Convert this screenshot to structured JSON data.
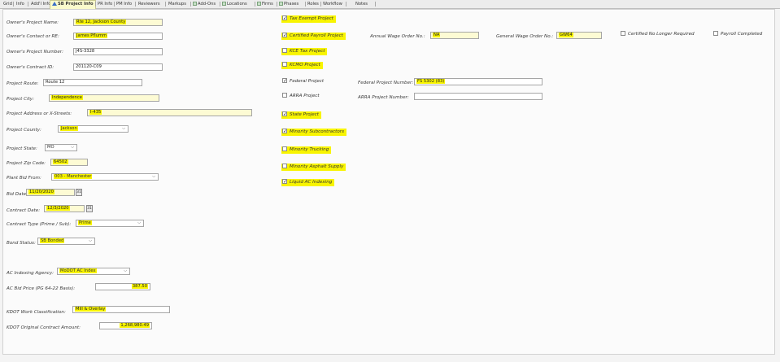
{
  "tabs": [
    {
      "label": "Grid",
      "icon": "none"
    },
    {
      "label": "Info",
      "icon": "none"
    },
    {
      "label": "Add'l Info",
      "icon": "none"
    },
    {
      "label": "SB Project Info",
      "icon": "triangle-icon",
      "active": true
    },
    {
      "label": "PR Info",
      "icon": "none"
    },
    {
      "label": "PM Info",
      "icon": "none"
    },
    {
      "label": "Reviewers",
      "icon": "none"
    },
    {
      "label": "Markups",
      "icon": "none"
    },
    {
      "label": "Add-Ons",
      "icon": "grid-icon"
    },
    {
      "label": "Locations",
      "icon": "grid-icon"
    },
    {
      "label": "Firms",
      "icon": "grid-icon"
    },
    {
      "label": "Phases",
      "icon": "grid-icon"
    },
    {
      "label": "Roles",
      "icon": "none"
    },
    {
      "label": "Workflow",
      "icon": "none"
    },
    {
      "label": "Notes",
      "icon": "none"
    }
  ],
  "form": {
    "project_name": {
      "label": "Owner's Project Name:",
      "value": "Rte 12, Jackson County"
    },
    "contact": {
      "label": "Owner's Contact or RE:",
      "value": "James Pflumm"
    },
    "project_number": {
      "label": "Owner's Project Number:",
      "value": "J4S-3328"
    },
    "contract_id": {
      "label": "Owner's Contract ID:",
      "value": "201120-C09"
    },
    "route": {
      "label": "Project Route:",
      "value": "Route 12"
    },
    "city": {
      "label": "Project City:",
      "value": "Independence"
    },
    "address": {
      "label": "Project Address or X-Streets:",
      "value": "I-435"
    },
    "county": {
      "label": "Project County:",
      "value": "Jackson"
    },
    "state": {
      "label": "Project State:",
      "value": "MO"
    },
    "zip": {
      "label": "Project Zip Code:",
      "value": "64502"
    },
    "plant": {
      "label": "Plant Bid From:",
      "value": "003 - Manchester"
    },
    "bid_date": {
      "label": "Bid Date:",
      "value": "11/20/2020"
    },
    "contract_date": {
      "label": "Contract Date:",
      "value": "12/3/2020"
    },
    "contract_type": {
      "label": "Contract Type (Prime / Sub):",
      "value": "Prime"
    },
    "bond_status": {
      "label": "Bond Status:",
      "value": "SB Bonded"
    },
    "ac_agency": {
      "label": "AC Indexing Agency:",
      "value": "MoDOT AC Index"
    },
    "ac_bid_price": {
      "label": "AC Bid Price (PG 64-22 Basis):",
      "value": "387.50"
    },
    "kdot_class": {
      "label": "KDOT Work Classification:",
      "value": "Mill & Overlay"
    },
    "kdot_amount": {
      "label": "KDOT Original Contract Amount:",
      "value": "1,268,980.49"
    }
  },
  "checks": [
    {
      "label": "Tax Exempt Project",
      "checked": true,
      "highlight": true
    },
    {
      "label": "Certified Payroll Project",
      "checked": true,
      "highlight": true
    },
    {
      "label": "KCE Tax Project",
      "checked": false,
      "highlight": true
    },
    {
      "label": "KCMO Project",
      "checked": false,
      "highlight": true
    },
    {
      "label": "Federal Project",
      "checked": true,
      "highlight": false
    },
    {
      "label": "ARRA Project",
      "checked": false,
      "highlight": false
    },
    {
      "label": "State Project",
      "checked": true,
      "highlight": true
    },
    {
      "label": "Minority Subcontractors",
      "checked": true,
      "highlight": true
    },
    {
      "label": "Minority Trucking",
      "checked": false,
      "highlight": true
    },
    {
      "label": "Minority Asphalt Supply",
      "checked": false,
      "highlight": true
    },
    {
      "label": "Liquid AC Indexing",
      "checked": true,
      "highlight": true
    }
  ],
  "wage": {
    "avg_label": "Annual Wage Order No.:",
    "avg_value": "NA",
    "gen_label": "General Wage Order No.:",
    "gen_value": "GW64"
  },
  "federal": {
    "label": "Federal Project Number:",
    "value": "FS 5302 (83)"
  },
  "arra": {
    "label": "ARRA Project Number:",
    "value": ""
  },
  "right_checks": [
    {
      "label": "Certified No Longer Required",
      "checked": false
    },
    {
      "label": "Payroll Completed",
      "checked": false
    }
  ],
  "calendar_glyph": "31",
  "dropdown_glyph": "⌵",
  "check_glyph": "✓",
  "highlight_color": "#f8f400"
}
